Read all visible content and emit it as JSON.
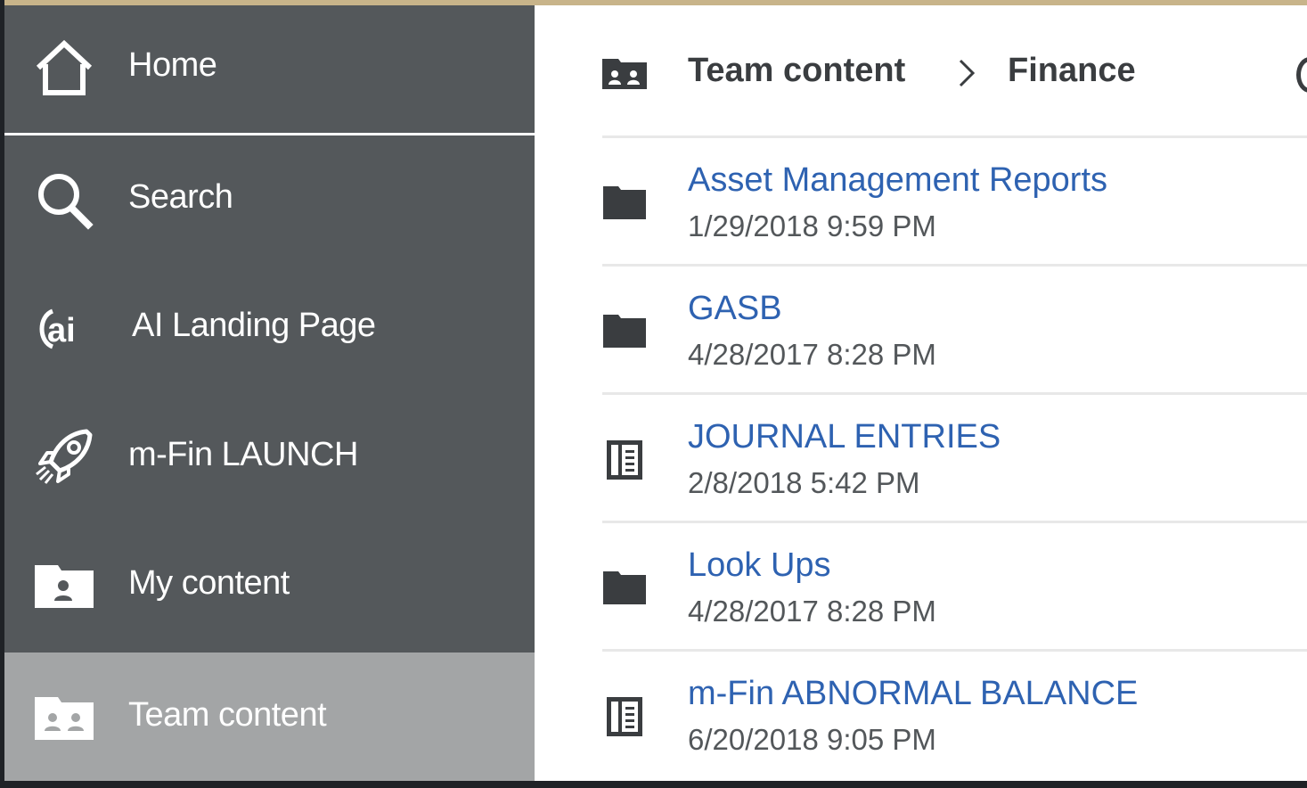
{
  "sidebar": {
    "items": [
      {
        "label": "Home",
        "icon": "home-icon"
      },
      {
        "label": "Search",
        "icon": "search-icon"
      },
      {
        "label": "AI Landing Page",
        "icon": "ai-icon"
      },
      {
        "label": "m-Fin LAUNCH",
        "icon": "rocket-icon"
      },
      {
        "label": "My content",
        "icon": "my-content-folder-icon"
      },
      {
        "label": "Team content",
        "icon": "team-content-folder-icon",
        "active": true
      }
    ]
  },
  "breadcrumb": {
    "icon": "team-content-folder-icon",
    "items": [
      "Team content",
      "Finance"
    ]
  },
  "content": {
    "rows": [
      {
        "title": "Asset Management Reports",
        "date": "1/29/2018 9:59 PM",
        "icon": "folder-icon"
      },
      {
        "title": "GASB",
        "date": "4/28/2017 8:28 PM",
        "icon": "folder-icon"
      },
      {
        "title": "JOURNAL ENTRIES",
        "date": "2/8/2018 5:42 PM",
        "icon": "report-icon"
      },
      {
        "title": "Look Ups",
        "date": "4/28/2017 8:28 PM",
        "icon": "folder-icon"
      },
      {
        "title": "m-Fin ABNORMAL BALANCE",
        "date": "6/20/2018 9:05 PM",
        "icon": "report-icon"
      }
    ]
  },
  "colors": {
    "sidebar_bg": "#54585b",
    "sidebar_active_bg": "#a3a5a6",
    "accent_top": "#c8b48a",
    "link": "#2e62b1",
    "text_dark": "#3a3d40",
    "text_muted": "#53575a"
  }
}
